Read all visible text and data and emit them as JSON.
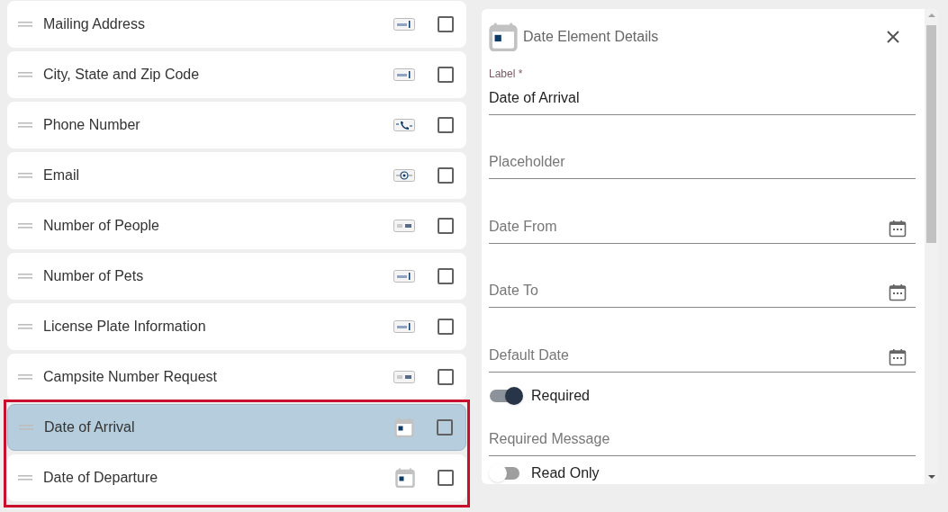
{
  "fields": [
    {
      "label": "Mailing Address",
      "kind": "text",
      "checked": false,
      "selected": false,
      "highlighted": false
    },
    {
      "label": "City, State and Zip Code",
      "kind": "text",
      "checked": false,
      "selected": false,
      "highlighted": false
    },
    {
      "label": "Phone Number",
      "kind": "phone",
      "checked": false,
      "selected": false,
      "highlighted": false
    },
    {
      "label": "Email",
      "kind": "email",
      "checked": false,
      "selected": false,
      "highlighted": false
    },
    {
      "label": "Number of People",
      "kind": "number",
      "checked": false,
      "selected": false,
      "highlighted": false
    },
    {
      "label": "Number of Pets",
      "kind": "text",
      "checked": false,
      "selected": false,
      "highlighted": false
    },
    {
      "label": "License Plate Information",
      "kind": "text",
      "checked": false,
      "selected": false,
      "highlighted": false
    },
    {
      "label": "Campsite Number Request",
      "kind": "number",
      "checked": false,
      "selected": false,
      "highlighted": false
    },
    {
      "label": "Date of Arrival",
      "kind": "date",
      "checked": false,
      "selected": true,
      "highlighted": true
    },
    {
      "label": "Date of Departure",
      "kind": "date",
      "checked": false,
      "selected": false,
      "highlighted": true
    }
  ],
  "details": {
    "title": "Date Element Details",
    "items": [
      {
        "kind": "filled",
        "label": "Label *",
        "value": "Date of Arrival"
      },
      {
        "kind": "text",
        "placeholder": "Placeholder"
      },
      {
        "kind": "date",
        "placeholder": "Date From"
      },
      {
        "kind": "date",
        "placeholder": "Date To"
      },
      {
        "kind": "date",
        "placeholder": "Default Date"
      },
      {
        "kind": "toggle",
        "label": "Required",
        "on": true
      },
      {
        "kind": "text",
        "placeholder": "Required Message"
      },
      {
        "kind": "toggle",
        "label": "Read Only",
        "on": false
      }
    ]
  }
}
